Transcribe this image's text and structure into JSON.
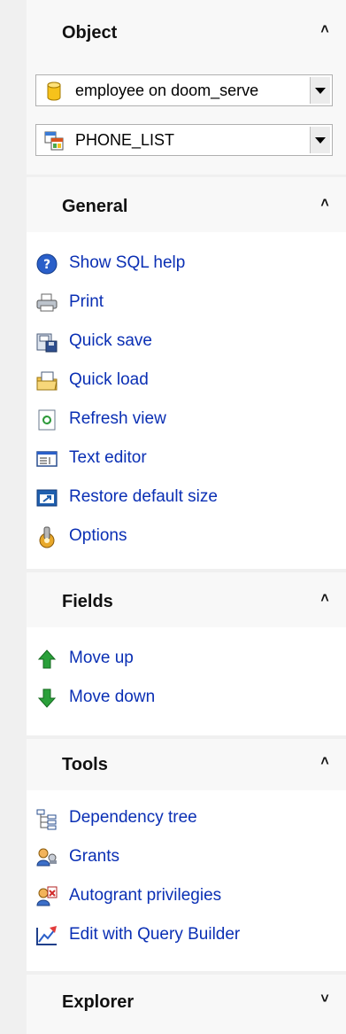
{
  "sections": {
    "object": {
      "title": "Object",
      "collapse_glyph": "˄",
      "database_select": {
        "value": "employee on doom_serve",
        "icon": "database-icon"
      },
      "table_select": {
        "value": "PHONE_LIST",
        "icon": "table-icon"
      }
    },
    "general": {
      "title": "General",
      "collapse_glyph": "˄",
      "items": [
        {
          "label": "Show SQL help",
          "icon": "help-icon"
        },
        {
          "label": "Print",
          "icon": "printer-icon"
        },
        {
          "label": "Quick save",
          "icon": "save-icon"
        },
        {
          "label": "Quick load",
          "icon": "load-icon"
        },
        {
          "label": "Refresh view",
          "icon": "refresh-icon"
        },
        {
          "label": "Text editor",
          "icon": "text-editor-icon"
        },
        {
          "label": "Restore default size",
          "icon": "restore-size-icon"
        },
        {
          "label": "Options",
          "icon": "options-icon"
        }
      ]
    },
    "fields": {
      "title": "Fields",
      "collapse_glyph": "˄",
      "items": [
        {
          "label": "Move up",
          "icon": "arrow-up-icon"
        },
        {
          "label": "Move down",
          "icon": "arrow-down-icon"
        }
      ]
    },
    "tools": {
      "title": "Tools",
      "collapse_glyph": "˄",
      "items": [
        {
          "label": "Dependency tree",
          "icon": "dependency-tree-icon"
        },
        {
          "label": "Grants",
          "icon": "grants-icon"
        },
        {
          "label": "Autogrant privilegies",
          "icon": "autogrant-icon"
        },
        {
          "label": "Edit with Query Builder",
          "icon": "query-builder-icon"
        }
      ]
    },
    "explorer": {
      "title": "Explorer",
      "expand_glyph": "˅"
    }
  },
  "colors": {
    "link": "#0a2fb4",
    "panel_header": "#f8f8f8",
    "panel_body": "#ffffff",
    "background": "#f0f0f0"
  }
}
